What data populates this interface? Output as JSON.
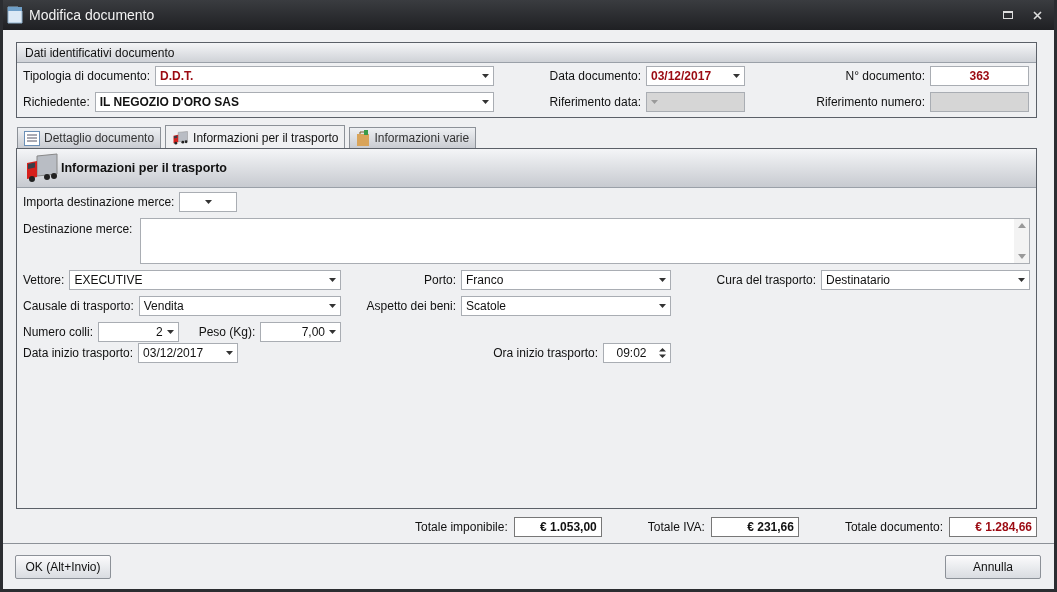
{
  "window": {
    "title": "Modifica documento"
  },
  "document_info": {
    "title": "Dati identificativi documento",
    "rows": [
      [
        {
          "label": "Tipologia di documento:",
          "value": "D.D.T.",
          "kind": "combo",
          "highlighted": true,
          "disabled": false
        },
        {
          "label": "Data documento:",
          "value": "03/12/2017",
          "kind": "combo",
          "highlighted": true,
          "disabled": false
        },
        {
          "label": "N° documento:",
          "value": "363",
          "kind": "text",
          "highlighted": true,
          "disabled": false
        }
      ],
      [
        {
          "label": "Richiedente:",
          "value": "IL NEGOZIO D'ORO SAS",
          "kind": "combo",
          "highlighted": false,
          "disabled": false
        },
        {
          "label": "Riferimento data:",
          "kind": "combo",
          "disabled": true
        },
        {
          "label": "Riferimento numero:",
          "kind": "text",
          "disabled": true
        }
      ]
    ]
  },
  "tabs": [
    {
      "label": "Dettaglio documento",
      "selected": false
    },
    {
      "label": "Informazioni per il trasporto",
      "selected": true
    },
    {
      "label": "Informazioni varie",
      "selected": false
    }
  ],
  "transport": {
    "title": "Informazioni per il trasporto",
    "rows": [
      {
        "left": [
          {
            "label": "Importa destinazione merce:",
            "kind": "picker"
          }
        ]
      },
      {
        "left": [
          {
            "label": "Destinazione merce:",
            "kind": "memo"
          }
        ]
      },
      {
        "left": [
          {
            "label": "Vettore:",
            "value": "EXECUTIVE",
            "kind": "combo"
          }
        ],
        "middle": [
          {
            "label": "Porto:",
            "value": "Franco",
            "kind": "combo"
          }
        ],
        "right": [
          {
            "label": "Cura del trasporto:",
            "value": "Destinatario",
            "kind": "combo"
          }
        ]
      },
      {
        "left": [
          {
            "label": "Causale di trasporto:",
            "value": "Vendita",
            "kind": "combo"
          }
        ],
        "middle": [
          {
            "label": "Aspetto dei beni:",
            "value": "Scatole",
            "kind": "combo"
          }
        ]
      },
      {
        "left": [
          {
            "label": "Numero colli:",
            "value": "2",
            "kind": "number"
          },
          {
            "label": "Peso (Kg):",
            "value": "7,00",
            "kind": "number"
          }
        ]
      },
      {
        "left": [
          {
            "label": "Data inizio trasporto:",
            "value": "03/12/2017",
            "kind": "date"
          }
        ],
        "middle": [
          {
            "label": "Ora inizio trasporto:",
            "value": "09:02",
            "kind": "time"
          }
        ]
      }
    ]
  },
  "totals": [
    {
      "label": "Totale imponibile:",
      "value": "€ 1.053,00",
      "highlighted": false
    },
    {
      "label": "Totale IVA:",
      "value": "€ 231,66",
      "highlighted": false
    },
    {
      "label": "Totale documento:",
      "value": "€ 1.284,66",
      "highlighted": true
    }
  ],
  "buttons": [
    {
      "label": "OK (Alt+Invio)"
    },
    {
      "label": "Annulla"
    }
  ]
}
